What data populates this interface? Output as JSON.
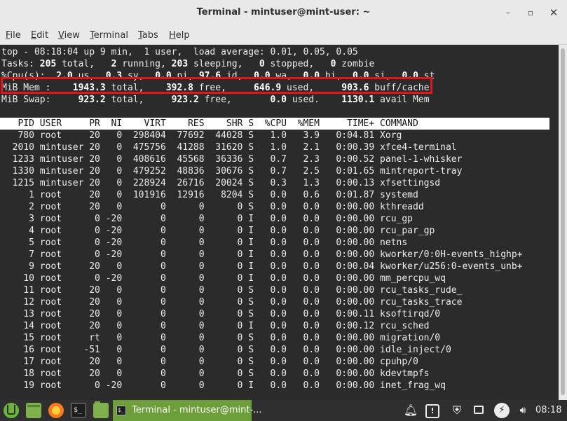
{
  "window": {
    "title": "Terminal - mintuser@mint-user: ~",
    "controls": {
      "minimize": "–",
      "maximize": "▫",
      "close": "✕"
    }
  },
  "menu": [
    {
      "label": "File",
      "accel": "F",
      "rest": "ile"
    },
    {
      "label": "Edit",
      "accel": "E",
      "rest": "dit"
    },
    {
      "label": "View",
      "accel": "V",
      "rest": "iew"
    },
    {
      "label": "Terminal",
      "accel": "T",
      "rest": "erminal"
    },
    {
      "label": "Tabs",
      "accel": "T",
      "rest": "abs"
    },
    {
      "label": "Help",
      "accel": "H",
      "rest": "elp"
    }
  ],
  "top": {
    "uptime_line": "top - 08:18:04 up 9 min,  1 user,  load average: 0.01, 0.05, 0.05",
    "tasks": {
      "label": "Tasks:",
      "total": "205",
      "total_label": "total,",
      "running": "2",
      "running_label": "running,",
      "sleeping": "203",
      "sleeping_label": "sleeping,",
      "stopped": "0",
      "stopped_label": "stopped,",
      "zombie": "0",
      "zombie_label": "zombie"
    },
    "cpu": {
      "label": "%Cpu(s):",
      "us": "2.0",
      "sy": "0.3",
      "ni": "0.0",
      "id": "97.6",
      "wa": "0.0",
      "hi": "0.0",
      "si": "0.0",
      "st": ""
    },
    "mem": {
      "label": "MiB Mem :",
      "total": "1943.3",
      "total_label": "total,",
      "free": "392.8",
      "free_label": "free,",
      "used": "646.9",
      "used_label": "used,",
      "cache": "903.6",
      "cache_label": "buff/cache"
    },
    "swap": {
      "label": "MiB Swap:",
      "total": "923.2",
      "total_label": "total,",
      "free": "923.2",
      "free_label": "free,",
      "used": "0.0",
      "used_label": "used.",
      "avail": "1130.1",
      "avail_label": "avail Mem"
    },
    "columns": [
      "PID",
      "USER",
      "PR",
      "NI",
      "VIRT",
      "RES",
      "SHR",
      "S",
      "%CPU",
      "%MEM",
      "TIME+",
      "COMMAND"
    ],
    "processes": [
      [
        "780",
        "root",
        "20",
        "0",
        "298404",
        "77692",
        "44028",
        "S",
        "1.0",
        "3.9",
        "0:04.81",
        "Xorg"
      ],
      [
        "2010",
        "mintuser",
        "20",
        "0",
        "475756",
        "41288",
        "31620",
        "S",
        "1.0",
        "2.1",
        "0:00.39",
        "xfce4-terminal"
      ],
      [
        "1233",
        "mintuser",
        "20",
        "0",
        "408616",
        "45568",
        "36336",
        "S",
        "0.7",
        "2.3",
        "0:00.52",
        "panel-1-whisker"
      ],
      [
        "1330",
        "mintuser",
        "20",
        "0",
        "479252",
        "48836",
        "30676",
        "S",
        "0.7",
        "2.5",
        "0:01.65",
        "mintreport-tray"
      ],
      [
        "1215",
        "mintuser",
        "20",
        "0",
        "228924",
        "26716",
        "20024",
        "S",
        "0.3",
        "1.3",
        "0:00.13",
        "xfsettingsd"
      ],
      [
        "1",
        "root",
        "20",
        "0",
        "101916",
        "12916",
        "8204",
        "S",
        "0.0",
        "0.6",
        "0:01.87",
        "systemd"
      ],
      [
        "2",
        "root",
        "20",
        "0",
        "0",
        "0",
        "0",
        "S",
        "0.0",
        "0.0",
        "0:00.00",
        "kthreadd"
      ],
      [
        "3",
        "root",
        "0",
        "-20",
        "0",
        "0",
        "0",
        "I",
        "0.0",
        "0.0",
        "0:00.00",
        "rcu_gp"
      ],
      [
        "4",
        "root",
        "0",
        "-20",
        "0",
        "0",
        "0",
        "I",
        "0.0",
        "0.0",
        "0:00.00",
        "rcu_par_gp"
      ],
      [
        "5",
        "root",
        "0",
        "-20",
        "0",
        "0",
        "0",
        "I",
        "0.0",
        "0.0",
        "0:00.00",
        "netns"
      ],
      [
        "7",
        "root",
        "0",
        "-20",
        "0",
        "0",
        "0",
        "I",
        "0.0",
        "0.0",
        "0:00.00",
        "kworker/0:0H-events_highp+"
      ],
      [
        "9",
        "root",
        "20",
        "0",
        "0",
        "0",
        "0",
        "I",
        "0.0",
        "0.0",
        "0:00.04",
        "kworker/u256:0-events_unb+"
      ],
      [
        "10",
        "root",
        "0",
        "-20",
        "0",
        "0",
        "0",
        "I",
        "0.0",
        "0.0",
        "0:00.00",
        "mm_percpu_wq"
      ],
      [
        "11",
        "root",
        "20",
        "0",
        "0",
        "0",
        "0",
        "S",
        "0.0",
        "0.0",
        "0:00.00",
        "rcu_tasks_rude_"
      ],
      [
        "12",
        "root",
        "20",
        "0",
        "0",
        "0",
        "0",
        "S",
        "0.0",
        "0.0",
        "0:00.00",
        "rcu_tasks_trace"
      ],
      [
        "13",
        "root",
        "20",
        "0",
        "0",
        "0",
        "0",
        "S",
        "0.0",
        "0.0",
        "0:00.11",
        "ksoftirqd/0"
      ],
      [
        "14",
        "root",
        "20",
        "0",
        "0",
        "0",
        "0",
        "I",
        "0.0",
        "0.0",
        "0:00.12",
        "rcu_sched"
      ],
      [
        "15",
        "root",
        "rt",
        "0",
        "0",
        "0",
        "0",
        "S",
        "0.0",
        "0.0",
        "0:00.00",
        "migration/0"
      ],
      [
        "16",
        "root",
        "-51",
        "0",
        "0",
        "0",
        "0",
        "S",
        "0.0",
        "0.0",
        "0:00.00",
        "idle_inject/0"
      ],
      [
        "17",
        "root",
        "20",
        "0",
        "0",
        "0",
        "0",
        "S",
        "0.0",
        "0.0",
        "0:00.00",
        "cpuhp/0"
      ],
      [
        "18",
        "root",
        "20",
        "0",
        "0",
        "0",
        "0",
        "S",
        "0.0",
        "0.0",
        "0:00.00",
        "kdevtmpfs"
      ],
      [
        "19",
        "root",
        "0",
        "-20",
        "0",
        "0",
        "0",
        "I",
        "0.0",
        "0.0",
        "0:00.00",
        "inet_frag_wq"
      ]
    ]
  },
  "highlight": {
    "color": "#e0161b"
  },
  "taskbar": {
    "icons": [
      "mint-menu-icon",
      "show-desktop-icon",
      "firefox-icon",
      "terminal-icon",
      "files-icon"
    ],
    "active_task": "Terminal - mintuser@mint-...",
    "tray": [
      "notification-icon",
      "update-manager-icon",
      "shield-icon",
      "window-icon",
      "power-icon",
      "volume-icon"
    ],
    "clock": "08:18"
  },
  "colors": {
    "terminal_bg": "#2b2b2b",
    "taskbar_active": "#6c9e3a",
    "chrome": "#e9e9e9"
  }
}
